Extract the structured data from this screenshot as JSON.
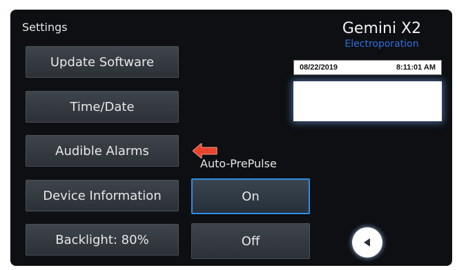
{
  "header": {
    "title": "Settings"
  },
  "menu": {
    "update_software": "Update Software",
    "time_date": "Time/Date",
    "audible_alarms": "Audible Alarms",
    "device_information": "Device Information",
    "backlight": "Backlight: 80%"
  },
  "brand": {
    "name": "Gemini X2",
    "subtitle": "Electroporation"
  },
  "status": {
    "date": "08/22/2019",
    "time": "8:11:01 AM"
  },
  "prepulse": {
    "label": "Auto-PrePulse",
    "on_label": "On",
    "off_label": "Off",
    "selected": "On"
  },
  "colors": {
    "accent_blue": "#2d8fe6",
    "arrow_red": "#e8432c",
    "brand_blue": "#2f6fe0"
  },
  "icons": {
    "back": "triangle-left-icon",
    "callout": "red-arrow-left-icon"
  }
}
